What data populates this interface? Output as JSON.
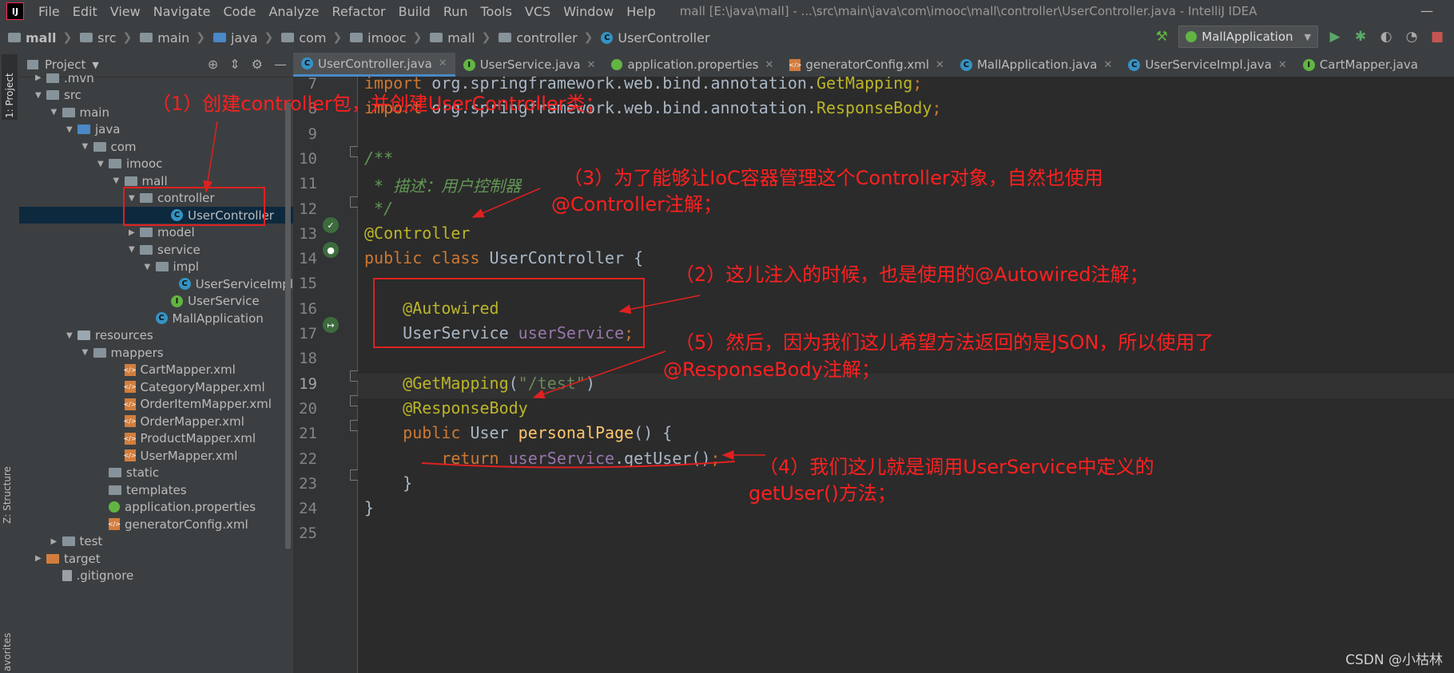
{
  "menubar": {
    "logo": "IJ",
    "items": [
      "File",
      "Edit",
      "View",
      "Navigate",
      "Code",
      "Analyze",
      "Refactor",
      "Build",
      "Run",
      "Tools",
      "VCS",
      "Window",
      "Help"
    ],
    "title": "mall [E:\\java\\mall] - ...\\src\\main\\java\\com\\imooc\\mall\\controller\\UserController.java - IntelliJ IDEA",
    "minimize": "—"
  },
  "breadcrumb": {
    "items": [
      "mall",
      "src",
      "main",
      "java",
      "com",
      "imooc",
      "mall",
      "controller"
    ],
    "class_name": "UserController"
  },
  "toolbar": {
    "run_config": "MallApplication",
    "icons": [
      "hammer-icon",
      "run-icon",
      "debug-icon",
      "coverage-icon",
      "profile-icon",
      "stop-icon"
    ]
  },
  "left_tabs": {
    "project": "1: Project",
    "structure": "Z: Structure",
    "favorites": "avorites"
  },
  "project_panel": {
    "title": "Project",
    "rows": [
      {
        "label": ".mvn",
        "indent": 0,
        "arrow": "▶",
        "icon": "folder"
      },
      {
        "label": "src",
        "indent": 0,
        "arrow": "▼",
        "icon": "folder"
      },
      {
        "label": "main",
        "indent": 1,
        "arrow": "▼",
        "icon": "folder"
      },
      {
        "label": "java",
        "indent": 2,
        "arrow": "▼",
        "icon": "folder-blue"
      },
      {
        "label": "com",
        "indent": 3,
        "arrow": "▼",
        "icon": "package"
      },
      {
        "label": "imooc",
        "indent": 4,
        "arrow": "▼",
        "icon": "package"
      },
      {
        "label": "mall",
        "indent": 5,
        "arrow": "▼",
        "icon": "package"
      },
      {
        "label": "controller",
        "indent": 6,
        "arrow": "▼",
        "icon": "package"
      },
      {
        "label": "UserController",
        "indent": 8,
        "arrow": "",
        "icon": "class",
        "selected": true
      },
      {
        "label": "model",
        "indent": 6,
        "arrow": "▶",
        "icon": "package"
      },
      {
        "label": "service",
        "indent": 6,
        "arrow": "▼",
        "icon": "package"
      },
      {
        "label": "impl",
        "indent": 7,
        "arrow": "▼",
        "icon": "package"
      },
      {
        "label": "UserServiceImpl",
        "indent": 9,
        "arrow": "",
        "icon": "class"
      },
      {
        "label": "UserService",
        "indent": 8,
        "arrow": "",
        "icon": "interface"
      },
      {
        "label": "MallApplication",
        "indent": 7,
        "arrow": "",
        "icon": "spring-class"
      },
      {
        "label": "resources",
        "indent": 2,
        "arrow": "▼",
        "icon": "folder-res"
      },
      {
        "label": "mappers",
        "indent": 3,
        "arrow": "▼",
        "icon": "folder"
      },
      {
        "label": "CartMapper.xml",
        "indent": 5,
        "arrow": "",
        "icon": "xml"
      },
      {
        "label": "CategoryMapper.xml",
        "indent": 5,
        "arrow": "",
        "icon": "xml"
      },
      {
        "label": "OrderItemMapper.xml",
        "indent": 5,
        "arrow": "",
        "icon": "xml"
      },
      {
        "label": "OrderMapper.xml",
        "indent": 5,
        "arrow": "",
        "icon": "xml"
      },
      {
        "label": "ProductMapper.xml",
        "indent": 5,
        "arrow": "",
        "icon": "xml"
      },
      {
        "label": "UserMapper.xml",
        "indent": 5,
        "arrow": "",
        "icon": "xml"
      },
      {
        "label": "static",
        "indent": 4,
        "arrow": "",
        "icon": "folder"
      },
      {
        "label": "templates",
        "indent": 4,
        "arrow": "",
        "icon": "folder"
      },
      {
        "label": "application.properties",
        "indent": 4,
        "arrow": "",
        "icon": "properties"
      },
      {
        "label": "generatorConfig.xml",
        "indent": 4,
        "arrow": "",
        "icon": "xml"
      },
      {
        "label": "test",
        "indent": 1,
        "arrow": "▶",
        "icon": "folder"
      },
      {
        "label": "target",
        "indent": 0,
        "arrow": "▶",
        "icon": "folder-orange"
      },
      {
        "label": ".gitignore",
        "indent": 1,
        "arrow": "",
        "icon": "file"
      }
    ]
  },
  "tabs": [
    {
      "label": "UserController.java",
      "icon": "class",
      "active": true
    },
    {
      "label": "UserService.java",
      "icon": "interface"
    },
    {
      "label": "application.properties",
      "icon": "properties"
    },
    {
      "label": "generatorConfig.xml",
      "icon": "xml"
    },
    {
      "label": "MallApplication.java",
      "icon": "spring-class"
    },
    {
      "label": "UserServiceImpl.java",
      "icon": "class"
    },
    {
      "label": "CartMapper.java",
      "icon": "interface"
    }
  ],
  "editor": {
    "line_numbers": [
      "7",
      "8",
      "9",
      "10",
      "11",
      "12",
      "13",
      "14",
      "15",
      "16",
      "17",
      "18",
      "19",
      "20",
      "21",
      "22",
      "23",
      "24",
      "25"
    ],
    "current_line": "19",
    "lines": [
      [
        [
          "kw",
          "import "
        ],
        [
          "",
          "org.springframework.web.bind.annotation."
        ],
        [
          "ann",
          "GetMapping"
        ],
        [
          "kw",
          ";"
        ]
      ],
      [
        [
          "kw",
          "import "
        ],
        [
          "",
          "org.springframework.web.bind.annotation."
        ],
        [
          "ann",
          "ResponseBody"
        ],
        [
          "kw",
          ";"
        ]
      ],
      [],
      [
        [
          "cmt",
          "/**"
        ]
      ],
      [
        [
          "cmt",
          " * 描述：用户控制器"
        ]
      ],
      [
        [
          "cmt",
          " */"
        ]
      ],
      [
        [
          "ann",
          "@Controller"
        ]
      ],
      [
        [
          "kw",
          "public class "
        ],
        [
          "",
          "UserController {"
        ]
      ],
      [],
      [
        [
          "ann",
          "    @Autowired"
        ]
      ],
      [
        [
          "",
          "    UserService "
        ],
        [
          "fld",
          "userService"
        ],
        [
          "kw",
          ";"
        ]
      ],
      [],
      [
        [
          "ann",
          "    @GetMapping"
        ],
        [
          "",
          "("
        ],
        [
          "str",
          "\"/test\""
        ],
        [
          "",
          ")"
        ]
      ],
      [
        [
          "ann",
          "    @ResponseBody"
        ]
      ],
      [
        [
          "kw",
          "    public "
        ],
        [
          "",
          "User "
        ],
        [
          "mth",
          "personalPage"
        ],
        [
          "",
          "() {"
        ]
      ],
      [
        [
          "kw",
          "        return "
        ],
        [
          "fld",
          "userService"
        ],
        [
          "",
          ".getUser()"
        ],
        [
          "kw",
          ";"
        ]
      ],
      [
        [
          "",
          "    }"
        ]
      ],
      [
        [
          "",
          "}"
        ]
      ],
      []
    ]
  },
  "annotations": [
    "（1）创建controller包，并创建UserController类；",
    "（3）为了能够让IoC容器管理这个Controller对象，自然也使用",
    "@Controller注解；",
    "（2）这儿注入的时候，也是使用的@Autowired注解；",
    "（5）然后，因为我们这儿希望方法返回的是JSON，所以使用了",
    "@ResponseBody注解；",
    "（4）我们这儿就是调用UserService中定义的",
    "getUser()方法；"
  ],
  "watermark": "CSDN @小枯林"
}
